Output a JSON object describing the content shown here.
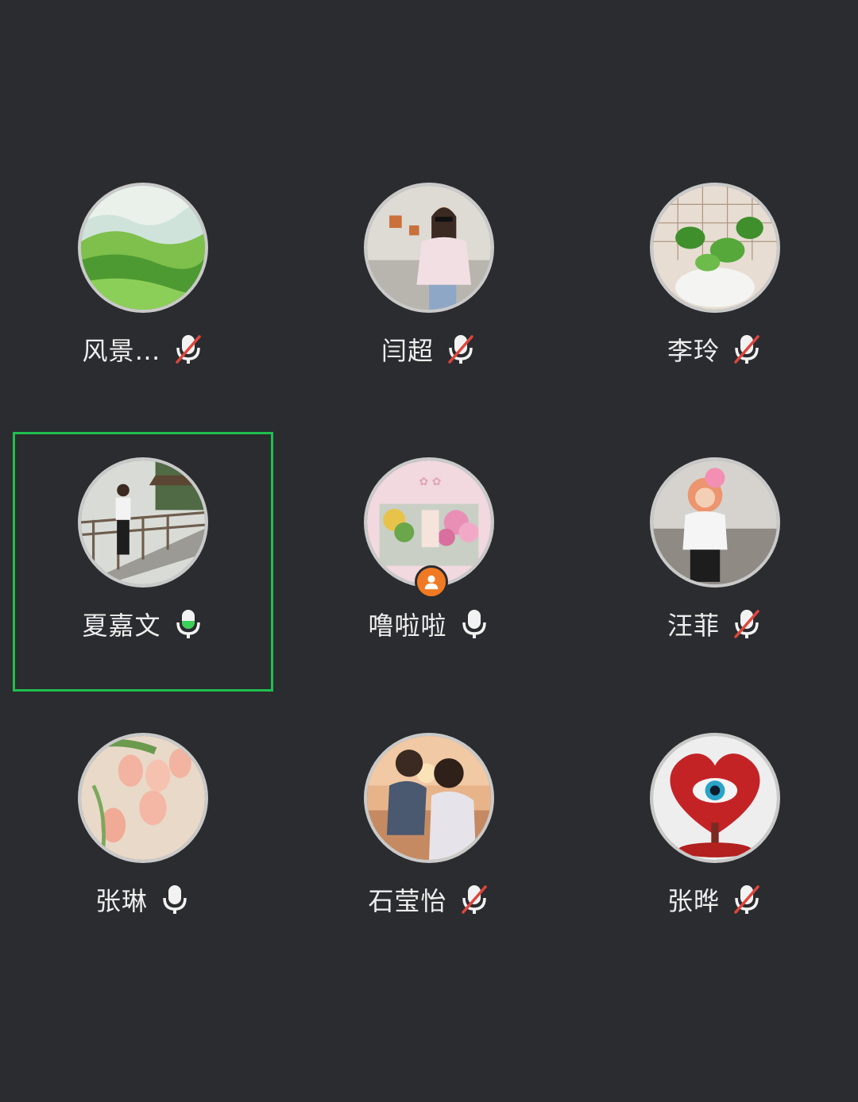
{
  "colors": {
    "background": "#2b2c2f",
    "speaking_border": "#1fbf4f",
    "mute_slash": "#e0453b",
    "voice_level": "#3ccf5a",
    "host_badge": "#f07a23"
  },
  "participants": [
    {
      "name": "风景…",
      "mic": "muted",
      "avatar": "landscape-painting"
    },
    {
      "name": "闫超",
      "mic": "muted",
      "avatar": "woman-sunglasses"
    },
    {
      "name": "李玲",
      "mic": "muted",
      "avatar": "potted-plant"
    },
    {
      "name": "夏嘉文",
      "mic": "speaking",
      "speaking": true,
      "avatar": "woman-on-bridge"
    },
    {
      "name": "噜啦啦",
      "mic": "on",
      "host": true,
      "avatar": "flower-shop"
    },
    {
      "name": "汪菲",
      "mic": "muted",
      "avatar": "child-balloon-hat"
    },
    {
      "name": "张琳",
      "mic": "on",
      "avatar": "tulips"
    },
    {
      "name": "石莹怡",
      "mic": "muted",
      "avatar": "mother-child-sunset"
    },
    {
      "name": "张晔",
      "mic": "muted",
      "avatar": "heart-tree-eye"
    }
  ]
}
